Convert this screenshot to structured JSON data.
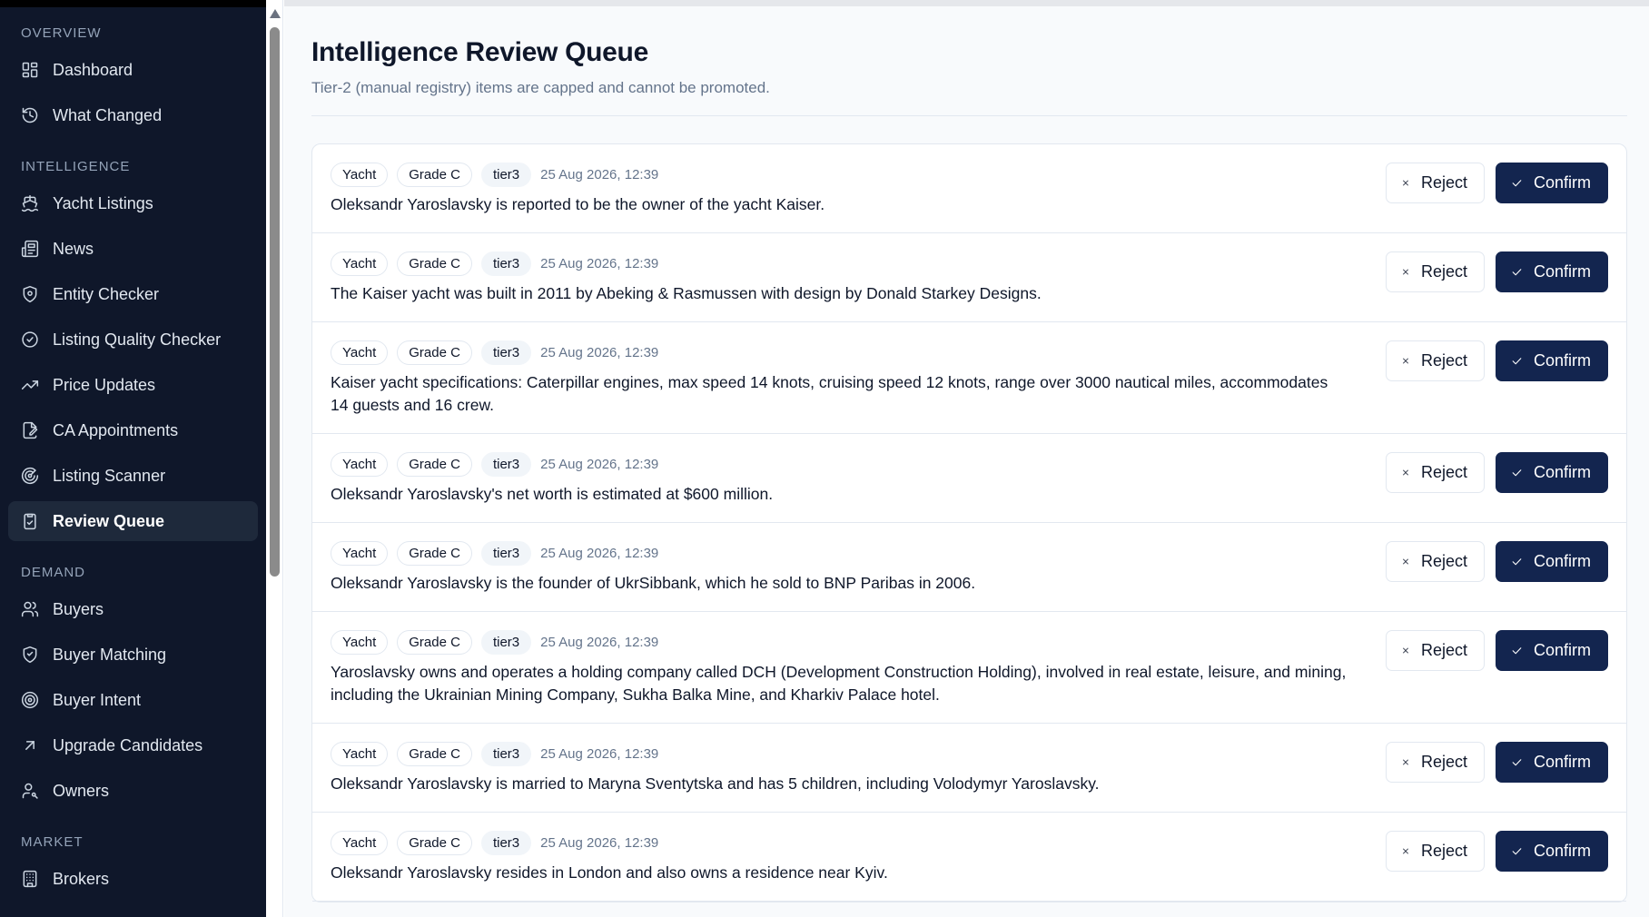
{
  "sidebar": {
    "sections": [
      {
        "title": "OVERVIEW",
        "items": [
          {
            "label": "Dashboard",
            "icon": "dashboard-icon"
          },
          {
            "label": "What Changed",
            "icon": "history-icon"
          }
        ]
      },
      {
        "title": "INTELLIGENCE",
        "items": [
          {
            "label": "Yacht Listings",
            "icon": "ship-icon"
          },
          {
            "label": "News",
            "icon": "newspaper-icon"
          },
          {
            "label": "Entity Checker",
            "icon": "shield-icon"
          },
          {
            "label": "Listing Quality Checker",
            "icon": "check-circle-icon"
          },
          {
            "label": "Price Updates",
            "icon": "trending-up-icon"
          },
          {
            "label": "CA Appointments",
            "icon": "file-signature-icon"
          },
          {
            "label": "Listing Scanner",
            "icon": "radar-icon"
          },
          {
            "label": "Review Queue",
            "icon": "clipboard-check-icon",
            "active": true
          }
        ]
      },
      {
        "title": "DEMAND",
        "items": [
          {
            "label": "Buyers",
            "icon": "users-icon"
          },
          {
            "label": "Buyer Matching",
            "icon": "shield-heart-icon"
          },
          {
            "label": "Buyer Intent",
            "icon": "target-icon"
          },
          {
            "label": "Upgrade Candidates",
            "icon": "arrow-up-right-icon"
          },
          {
            "label": "Owners",
            "icon": "user-key-icon"
          }
        ]
      },
      {
        "title": "MARKET",
        "items": [
          {
            "label": "Brokers",
            "icon": "building-icon"
          }
        ]
      }
    ]
  },
  "page": {
    "title": "Intelligence Review Queue",
    "subtitle": "Tier-2 (manual registry) items are capped and cannot be promoted."
  },
  "actions": {
    "reject_label": "Reject",
    "confirm_label": "Confirm"
  },
  "queue": [
    {
      "category": "Yacht",
      "grade": "Grade C",
      "tier": "tier3",
      "timestamp": "25 Aug 2026, 12:39",
      "text": "Oleksandr Yaroslavsky is reported to be the owner of the yacht Kaiser."
    },
    {
      "category": "Yacht",
      "grade": "Grade C",
      "tier": "tier3",
      "timestamp": "25 Aug 2026, 12:39",
      "text": "The Kaiser yacht was built in 2011 by Abeking & Rasmussen with design by Donald Starkey Designs."
    },
    {
      "category": "Yacht",
      "grade": "Grade C",
      "tier": "tier3",
      "timestamp": "25 Aug 2026, 12:39",
      "text": "Kaiser yacht specifications: Caterpillar engines, max speed 14 knots, cruising speed 12 knots, range over 3000 nautical miles, accommodates 14 guests and 16 crew."
    },
    {
      "category": "Yacht",
      "grade": "Grade C",
      "tier": "tier3",
      "timestamp": "25 Aug 2026, 12:39",
      "text": "Oleksandr Yaroslavsky's net worth is estimated at $600 million."
    },
    {
      "category": "Yacht",
      "grade": "Grade C",
      "tier": "tier3",
      "timestamp": "25 Aug 2026, 12:39",
      "text": "Oleksandr Yaroslavsky is the founder of UkrSibbank, which he sold to BNP Paribas in 2006."
    },
    {
      "category": "Yacht",
      "grade": "Grade C",
      "tier": "tier3",
      "timestamp": "25 Aug 2026, 12:39",
      "text": "Yaroslavsky owns and operates a holding company called DCH (Development Construction Holding), involved in real estate, leisure, and mining, including the Ukrainian Mining Company, Sukha Balka Mine, and Kharkiv Palace hotel."
    },
    {
      "category": "Yacht",
      "grade": "Grade C",
      "tier": "tier3",
      "timestamp": "25 Aug 2026, 12:39",
      "text": "Oleksandr Yaroslavsky is married to Maryna Sventytska and has 5 children, including Volodymyr Yaroslavsky."
    },
    {
      "category": "Yacht",
      "grade": "Grade C",
      "tier": "tier3",
      "timestamp": "25 Aug 2026, 12:39",
      "text": "Oleksandr Yaroslavsky resides in London and also owns a residence near Kyiv."
    }
  ]
}
